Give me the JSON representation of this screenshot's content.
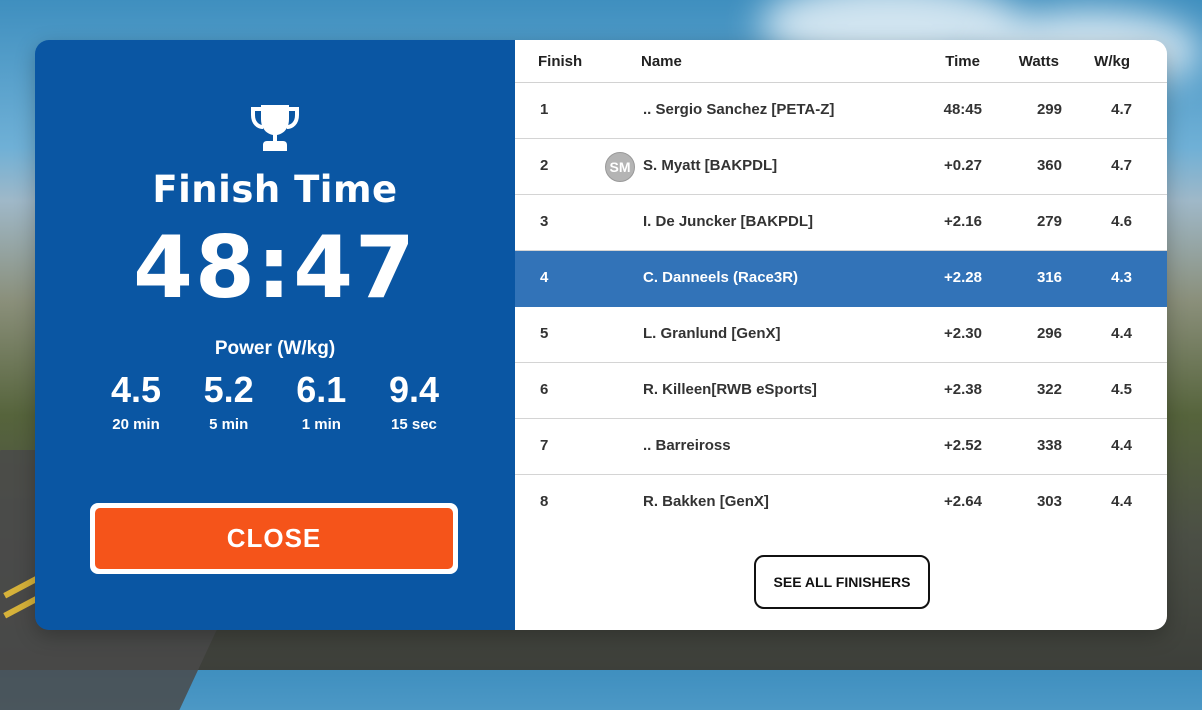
{
  "summary": {
    "finish_label": "Finish Time",
    "finish_time": "48:47",
    "power_label": "Power (W/kg)",
    "power_stats": [
      {
        "value": "4.5",
        "duration": "20 min"
      },
      {
        "value": "5.2",
        "duration": "5 min"
      },
      {
        "value": "6.1",
        "duration": "1 min"
      },
      {
        "value": "9.4",
        "duration": "15 sec"
      }
    ],
    "close_label": "CLOSE",
    "icon": "trophy-icon"
  },
  "table": {
    "headers": {
      "finish": "Finish",
      "name": "Name",
      "time": "Time",
      "watts": "Watts",
      "wkg": "W/kg"
    },
    "rows": [
      {
        "pos": "1",
        "avatar": "",
        "name": ".. Sergio Sanchez [PETA-Z]",
        "time": "48:45",
        "watts": "299",
        "wkg": "4.7"
      },
      {
        "pos": "2",
        "avatar": "SM",
        "name": "S. Myatt [BAKPDL]",
        "time": "+0.27",
        "watts": "360",
        "wkg": "4.7"
      },
      {
        "pos": "3",
        "avatar": "",
        "name": "I. De Juncker [BAKPDL]",
        "time": "+2.16",
        "watts": "279",
        "wkg": "4.6"
      },
      {
        "pos": "4",
        "avatar": "",
        "name": "C. Danneels (Race3R)",
        "time": "+2.28",
        "watts": "316",
        "wkg": "4.3",
        "highlighted": true
      },
      {
        "pos": "5",
        "avatar": "",
        "name": "L. Granlund [GenX]",
        "time": "+2.30",
        "watts": "296",
        "wkg": "4.4"
      },
      {
        "pos": "6",
        "avatar": "",
        "name": "R. Killeen[RWB eSports]",
        "time": "+2.38",
        "watts": "322",
        "wkg": "4.5"
      },
      {
        "pos": "7",
        "avatar": "",
        "name": ".. Barreiross",
        "time": "+2.52",
        "watts": "338",
        "wkg": "4.4"
      },
      {
        "pos": "8",
        "avatar": "",
        "name": "R. Bakken [GenX]",
        "time": "+2.64",
        "watts": "303",
        "wkg": "4.4"
      }
    ],
    "see_all_label": "SEE ALL FINISHERS"
  },
  "colors": {
    "panel_blue": "#0a56a3",
    "highlight_row": "#3273b8",
    "close_orange": "#f5541a"
  }
}
